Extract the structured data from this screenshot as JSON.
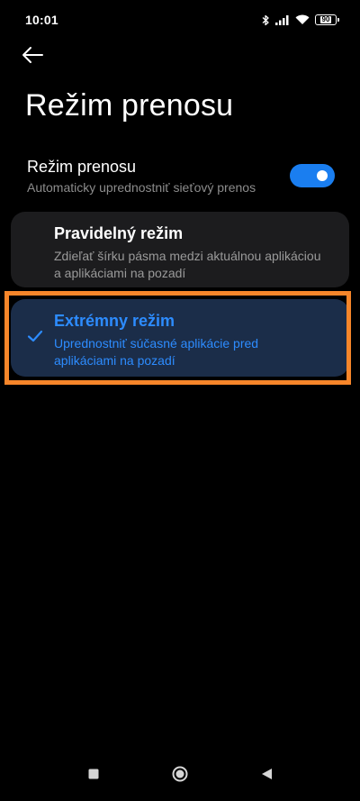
{
  "status_bar": {
    "time": "10:01",
    "battery": "90",
    "icons": [
      "bluetooth-icon",
      "signal-icon",
      "wifi-icon",
      "battery-icon"
    ]
  },
  "header": {
    "back_icon": "arrow-left-icon",
    "title": "Režim prenosu"
  },
  "toggle": {
    "title": "Režim prenosu",
    "subtitle": "Automaticky uprednostniť sieťový prenos",
    "enabled": true,
    "accent_color": "#1a7ef0"
  },
  "options": [
    {
      "title": "Pravidelný režim",
      "description": "Zdieľať šírku pásma medzi aktuálnou aplikáciou a aplikáciami na pozadí",
      "selected": false
    },
    {
      "title": "Extrémny režim",
      "description": "Uprednostniť súčasné aplikácie pred aplikáciami na pozadí",
      "selected": true
    }
  ],
  "colors": {
    "background": "#000000",
    "card": "#1c1c1e",
    "selected_card": "#1b2d49",
    "selected_text": "#2d8cff",
    "highlight": "#f7862a"
  },
  "nav_bar": {
    "buttons": [
      "recents-square-icon",
      "home-circle-icon",
      "back-triangle-icon"
    ]
  }
}
